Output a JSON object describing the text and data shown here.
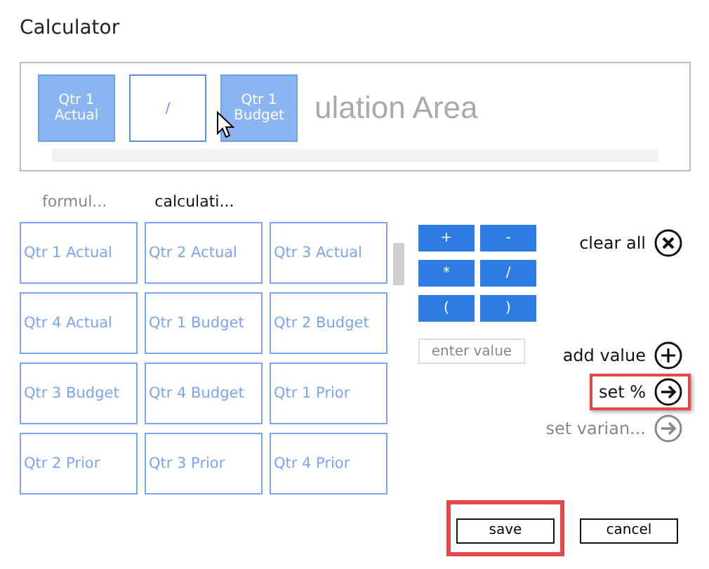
{
  "window": {
    "title": "Calculator"
  },
  "calculation_area": {
    "tokens": [
      {
        "text": "Qtr 1 Actual",
        "kind": "field"
      },
      {
        "text": "/",
        "kind": "operator"
      },
      {
        "text": "Qtr 1 Budget",
        "kind": "field"
      }
    ],
    "placeholder": "ulation Area"
  },
  "tabs": [
    {
      "label": "formul...",
      "selected": false
    },
    {
      "label": "calculati...",
      "selected": true
    }
  ],
  "fields": [
    "Qtr 1 Actual",
    "Qtr 2 Actual",
    "Qtr 3 Actual",
    "Qtr 4 Actual",
    "Qtr 1 Budget",
    "Qtr 2 Budget",
    "Qtr 3 Budget",
    "Qtr 4 Budget",
    "Qtr 1 Prior",
    "Qtr 2 Prior",
    "Qtr 3 Prior",
    "Qtr 4 Prior"
  ],
  "operators": [
    "+",
    "-",
    "*",
    "/",
    "(",
    ")"
  ],
  "value_input": {
    "placeholder": "enter value"
  },
  "actions": [
    {
      "label": "clear all",
      "kind": "clear",
      "disabled": false,
      "highlighted": false
    },
    {
      "label": "add value",
      "kind": "add",
      "disabled": false,
      "highlighted": false
    },
    {
      "label": "set %",
      "kind": "arrow",
      "disabled": false,
      "highlighted": true
    },
    {
      "label": "set varian...",
      "kind": "arrow",
      "disabled": true,
      "highlighted": false
    }
  ],
  "buttons": [
    {
      "label": "save",
      "highlighted": true
    },
    {
      "label": "cancel",
      "highlighted": false
    }
  ]
}
